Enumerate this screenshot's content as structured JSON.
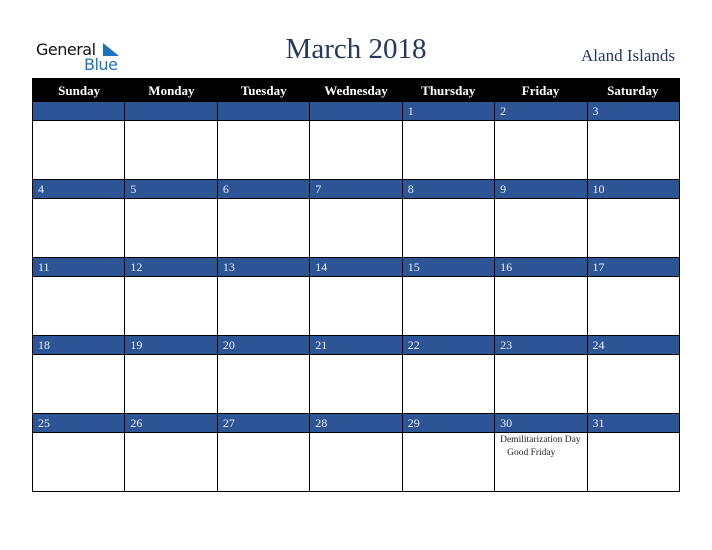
{
  "logo": {
    "word1": "General",
    "word2": "Blue",
    "icon": "triangle-flag-icon"
  },
  "header": {
    "title": "March 2018",
    "country": "Aland Islands"
  },
  "colors": {
    "accent": "#2d5596",
    "header_bg": "#000000",
    "title": "#23395d",
    "logo_blue": "#1e73be"
  },
  "weekdays": [
    "Sunday",
    "Monday",
    "Tuesday",
    "Wednesday",
    "Thursday",
    "Friday",
    "Saturday"
  ],
  "weeks": [
    [
      {
        "day": ""
      },
      {
        "day": ""
      },
      {
        "day": ""
      },
      {
        "day": ""
      },
      {
        "day": "1"
      },
      {
        "day": "2"
      },
      {
        "day": "3"
      }
    ],
    [
      {
        "day": "4"
      },
      {
        "day": "5"
      },
      {
        "day": "6"
      },
      {
        "day": "7"
      },
      {
        "day": "8"
      },
      {
        "day": "9"
      },
      {
        "day": "10"
      }
    ],
    [
      {
        "day": "11"
      },
      {
        "day": "12"
      },
      {
        "day": "13"
      },
      {
        "day": "14"
      },
      {
        "day": "15"
      },
      {
        "day": "16"
      },
      {
        "day": "17"
      }
    ],
    [
      {
        "day": "18"
      },
      {
        "day": "19"
      },
      {
        "day": "20"
      },
      {
        "day": "21"
      },
      {
        "day": "22"
      },
      {
        "day": "23"
      },
      {
        "day": "24"
      }
    ],
    [
      {
        "day": "25"
      },
      {
        "day": "26"
      },
      {
        "day": "27"
      },
      {
        "day": "28"
      },
      {
        "day": "29"
      },
      {
        "day": "30",
        "events": [
          "Demilitarization Day",
          "Good Friday"
        ]
      },
      {
        "day": "31"
      }
    ]
  ]
}
